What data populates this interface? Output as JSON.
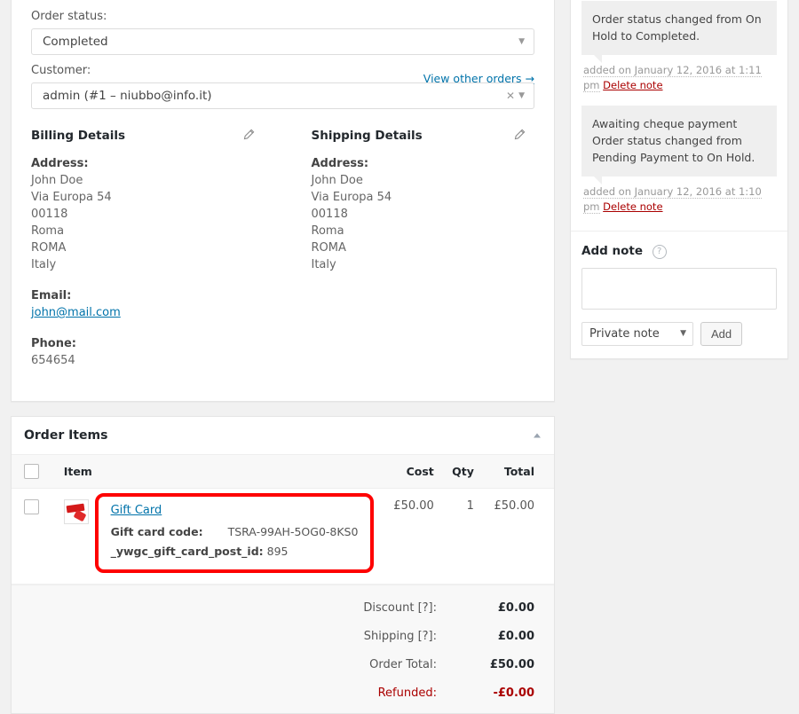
{
  "order_data": {
    "status_label": "Order status:",
    "status_value": "Completed",
    "customer_label": "Customer:",
    "customer_value": "admin (#1 – niubbo@info.it)",
    "view_other_orders": "View other orders →"
  },
  "billing": {
    "title": "Billing Details",
    "address_label": "Address:",
    "address_lines": [
      "John Doe",
      "Via Europa 54",
      "00118",
      "Roma",
      "ROMA",
      "Italy"
    ],
    "email_label": "Email:",
    "email_value": "john@mail.com",
    "phone_label": "Phone:",
    "phone_value": "654654"
  },
  "shipping": {
    "title": "Shipping Details",
    "address_label": "Address:",
    "address_lines": [
      "John Doe",
      "Via Europa 54",
      "00118",
      "Roma",
      "ROMA",
      "Italy"
    ]
  },
  "order_items": {
    "panel_title": "Order Items",
    "columns": {
      "item": "Item",
      "cost": "Cost",
      "qty": "Qty",
      "total": "Total"
    },
    "rows": [
      {
        "name": "Gift Card",
        "meta": [
          {
            "key": "Gift card code:",
            "value": "TSRA-99AH-5OG0-8KS0"
          },
          {
            "key": "_ywgc_gift_card_post_id:",
            "value": "895"
          }
        ],
        "cost": "£50.00",
        "qty": "1",
        "total": "£50.00"
      }
    ],
    "totals": [
      {
        "label": "Discount [?]:",
        "value": "£0.00",
        "type": "normal"
      },
      {
        "label": "Shipping [?]:",
        "value": "£0.00",
        "type": "normal"
      },
      {
        "label": "Order Total:",
        "value": "£50.00",
        "type": "normal"
      },
      {
        "label": "Refunded:",
        "value": "-£0.00",
        "type": "refund"
      }
    ],
    "highlight_color": "#fe0000"
  },
  "sidebar": {
    "notes": [
      {
        "text": "Order status changed from On Hold to Completed.",
        "added": "added on January 12, 2016 at 1:11 pm",
        "delete_label": "Delete note"
      },
      {
        "text": "Awaiting cheque payment Order status changed from Pending Payment to On Hold.",
        "added": "added on January 12, 2016 at 1:10 pm",
        "delete_label": "Delete note"
      }
    ],
    "add_note": {
      "title": "Add note",
      "textarea_value": "",
      "note_type": "Private note",
      "add_button": "Add"
    }
  }
}
